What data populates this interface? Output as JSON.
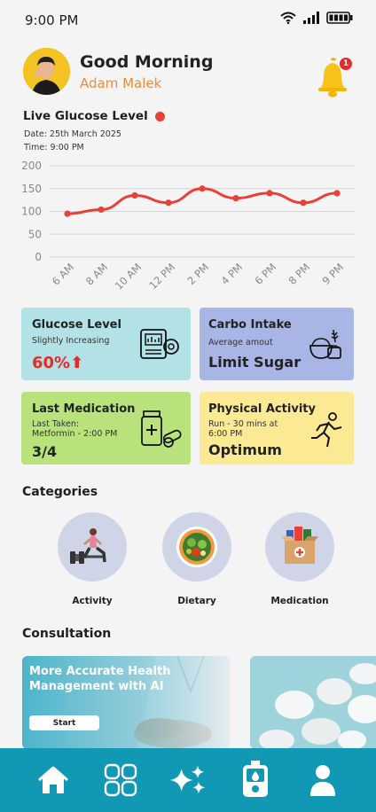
{
  "status": {
    "time": "9:00 PM"
  },
  "header": {
    "greeting": "Good Morning",
    "user_name": "Adam Malek",
    "notification_count": "1"
  },
  "glucose": {
    "title": "Live Glucose Level",
    "date": "Date: 25th March 2025",
    "time": "Time: 9:00 PM"
  },
  "chart_data": {
    "type": "line",
    "title": "Live Glucose Level",
    "categories": [
      "6 AM",
      "8 AM",
      "10 AM",
      "12 PM",
      "2 PM",
      "4 PM",
      "6 PM",
      "8 PM",
      "9 PM"
    ],
    "values": [
      95,
      104,
      135,
      119,
      150,
      129,
      140,
      119,
      140
    ],
    "yticks": [
      0,
      50,
      100,
      150,
      200
    ],
    "ylim": [
      0,
      200
    ],
    "grid": true,
    "color": "#e8413a"
  },
  "cards": {
    "glucose": {
      "title": "Glucose Level",
      "subtitle": "Slightly Increasing",
      "value": "60%",
      "arrow": "⬆",
      "bg": "#b3e2e6",
      "value_color": "#e32b2b"
    },
    "carbo": {
      "title": "Carbo Intake",
      "subtitle": "Average amout",
      "value": "Limit Sugar",
      "bg": "#a9b5e4"
    },
    "medication": {
      "title": "Last Medication",
      "subtitle_line1": "Last Taken:",
      "subtitle_line2": "Metformin - 2:00 PM",
      "value": "3/4",
      "bg": "#b9e27d"
    },
    "activity": {
      "title": "Physical Activity",
      "subtitle_line1": "Run - 30 mins at",
      "subtitle_line2": "6:00 PM",
      "value": "Optimum",
      "bg": "#fbe994"
    }
  },
  "categories": {
    "title": "Categories",
    "items": [
      {
        "label": "Activity",
        "icon": "exercise-icon"
      },
      {
        "label": "Dietary",
        "icon": "salad-bowl-icon"
      },
      {
        "label": "Medication",
        "icon": "medicine-box-icon"
      }
    ]
  },
  "consultation": {
    "title": "Consultation",
    "banner_text": "More Accurate Health Management with AI",
    "start_label": "Start"
  },
  "nav": {
    "items": [
      "home-icon",
      "grid-icon",
      "sparkles-icon",
      "glucose-meter-icon",
      "profile-icon"
    ]
  }
}
